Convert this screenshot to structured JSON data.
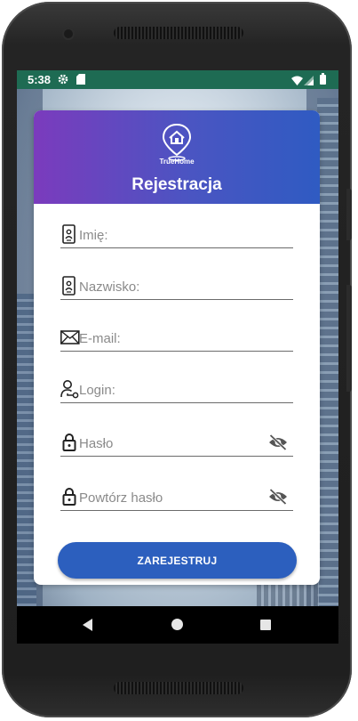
{
  "status_bar": {
    "time": "5:38"
  },
  "header": {
    "logo_text": "TrueHome",
    "title": "Rejestracja"
  },
  "form": {
    "first_name": {
      "placeholder": "Imię:"
    },
    "last_name": {
      "placeholder": "Nazwisko:"
    },
    "email": {
      "placeholder": "E-mail:"
    },
    "login": {
      "placeholder": "Login:"
    },
    "password": {
      "placeholder": "Hasło"
    },
    "password_repeat": {
      "placeholder": "Powtórz hasło"
    }
  },
  "register_button": {
    "label": "ZAREJESTRUJ"
  },
  "colors": {
    "accent": "#2c5fbe",
    "header_start": "#7b3bbd",
    "header_end": "#2f5bc2",
    "status_bar": "#1e6b53"
  },
  "icons": [
    "gear-icon",
    "sd-card-icon",
    "wifi-icon",
    "signal-icon",
    "battery-icon",
    "id-card-icon",
    "envelope-icon",
    "user-key-icon",
    "lock-icon",
    "eye-off-icon",
    "back-icon",
    "home-icon",
    "recent-apps-icon"
  ]
}
